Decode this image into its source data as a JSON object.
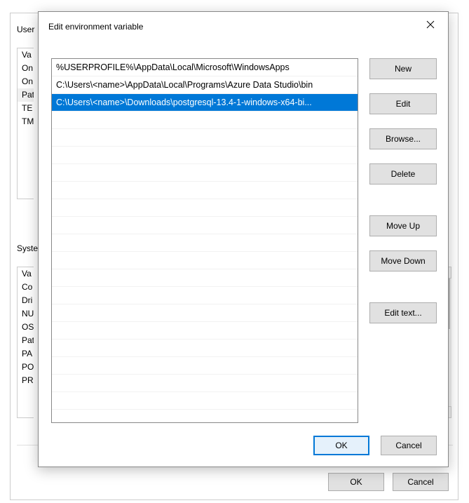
{
  "background": {
    "user_section_label": "User",
    "system_section_label": "Syste",
    "user_vars": [
      "Va",
      "On",
      "On",
      "Pat",
      "TE",
      "TM"
    ],
    "system_vars": [
      "Va",
      "Co",
      "Dri",
      "NU",
      "OS",
      "Pat",
      "PA",
      "PO",
      "PR"
    ],
    "buttons": {
      "ok": "OK",
      "cancel": "Cancel"
    }
  },
  "dialog": {
    "title": "Edit environment variable",
    "paths": [
      {
        "text": "%USERPROFILE%\\AppData\\Local\\Microsoft\\WindowsApps",
        "selected": false
      },
      {
        "text": "C:\\Users\\<name>\\AppData\\Local\\Programs\\Azure Data Studio\\bin",
        "selected": false
      },
      {
        "text": "C:\\Users\\<name>\\Downloads\\postgresql-13.4-1-windows-x64-bi...",
        "selected": true
      }
    ],
    "buttons": {
      "new": "New",
      "edit": "Edit",
      "browse": "Browse...",
      "delete": "Delete",
      "move_up": "Move Up",
      "move_down": "Move Down",
      "edit_text": "Edit text...",
      "ok": "OK",
      "cancel": "Cancel"
    }
  }
}
